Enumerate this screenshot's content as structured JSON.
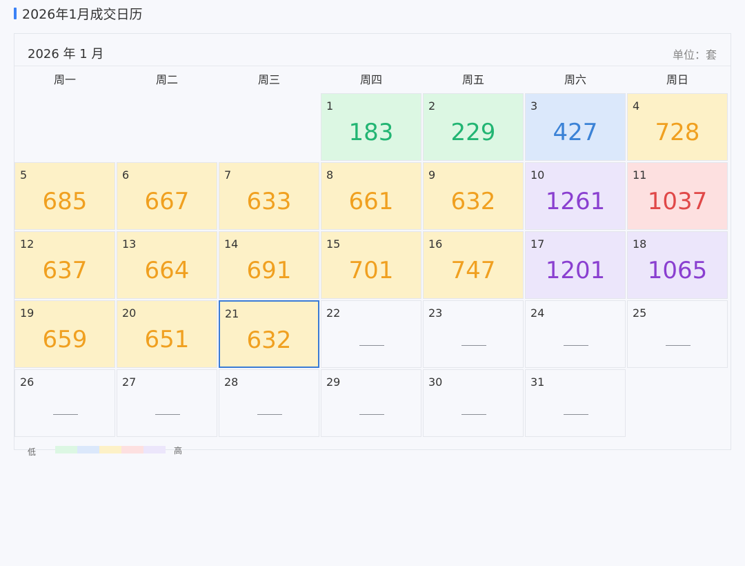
{
  "page_title": "2026年1月成交日历",
  "calendar": {
    "month_label": "2026 年 1 月",
    "unit_label": "单位：套",
    "weekdays": [
      "周一",
      "周二",
      "周三",
      "周四",
      "周五",
      "周六",
      "周日"
    ],
    "days": [
      {
        "day": "1",
        "value": "183",
        "level": "green"
      },
      {
        "day": "2",
        "value": "229",
        "level": "green"
      },
      {
        "day": "3",
        "value": "427",
        "level": "blue"
      },
      {
        "day": "4",
        "value": "728",
        "level": "yellow"
      },
      {
        "day": "5",
        "value": "685",
        "level": "yellow"
      },
      {
        "day": "6",
        "value": "667",
        "level": "yellow"
      },
      {
        "day": "7",
        "value": "633",
        "level": "yellow"
      },
      {
        "day": "8",
        "value": "661",
        "level": "yellow"
      },
      {
        "day": "9",
        "value": "632",
        "level": "yellow"
      },
      {
        "day": "10",
        "value": "1261",
        "level": "purple"
      },
      {
        "day": "11",
        "value": "1037",
        "level": "red"
      },
      {
        "day": "12",
        "value": "637",
        "level": "yellow"
      },
      {
        "day": "13",
        "value": "664",
        "level": "yellow"
      },
      {
        "day": "14",
        "value": "691",
        "level": "yellow"
      },
      {
        "day": "15",
        "value": "701",
        "level": "yellow"
      },
      {
        "day": "16",
        "value": "747",
        "level": "yellow"
      },
      {
        "day": "17",
        "value": "1201",
        "level": "purple"
      },
      {
        "day": "18",
        "value": "1065",
        "level": "purple"
      },
      {
        "day": "19",
        "value": "659",
        "level": "yellow"
      },
      {
        "day": "20",
        "value": "651",
        "level": "yellow"
      },
      {
        "day": "21",
        "value": "632",
        "level": "yellow",
        "selected": true
      },
      {
        "day": "22",
        "value": null,
        "level": "none"
      },
      {
        "day": "23",
        "value": null,
        "level": "none"
      },
      {
        "day": "24",
        "value": null,
        "level": "none"
      },
      {
        "day": "25",
        "value": null,
        "level": "none"
      },
      {
        "day": "26",
        "value": null,
        "level": "none"
      },
      {
        "day": "27",
        "value": null,
        "level": "none"
      },
      {
        "day": "28",
        "value": null,
        "level": "none"
      },
      {
        "day": "29",
        "value": null,
        "level": "none"
      },
      {
        "day": "30",
        "value": null,
        "level": "none"
      },
      {
        "day": "31",
        "value": null,
        "level": "none"
      }
    ],
    "first_weekday_index": 3
  },
  "levels": {
    "green": {
      "bg": "#dcf7e3",
      "fg": "#22b573"
    },
    "blue": {
      "bg": "#dbe8fb",
      "fg": "#3b82d6"
    },
    "yellow": {
      "bg": "#fdf1c7",
      "fg": "#f0a020"
    },
    "red": {
      "bg": "#fde0e0",
      "fg": "#e04848"
    },
    "purple": {
      "bg": "#ece6fb",
      "fg": "#8a3fd0"
    },
    "none": {
      "bg": "#f7f8fc",
      "fg": "#888888"
    }
  },
  "legend": {
    "low_label": "低",
    "high_label": "高",
    "swatches": [
      "#dcf7e3",
      "#dbe8fb",
      "#fdf1c7",
      "#fde0e0",
      "#ece6fb"
    ]
  }
}
